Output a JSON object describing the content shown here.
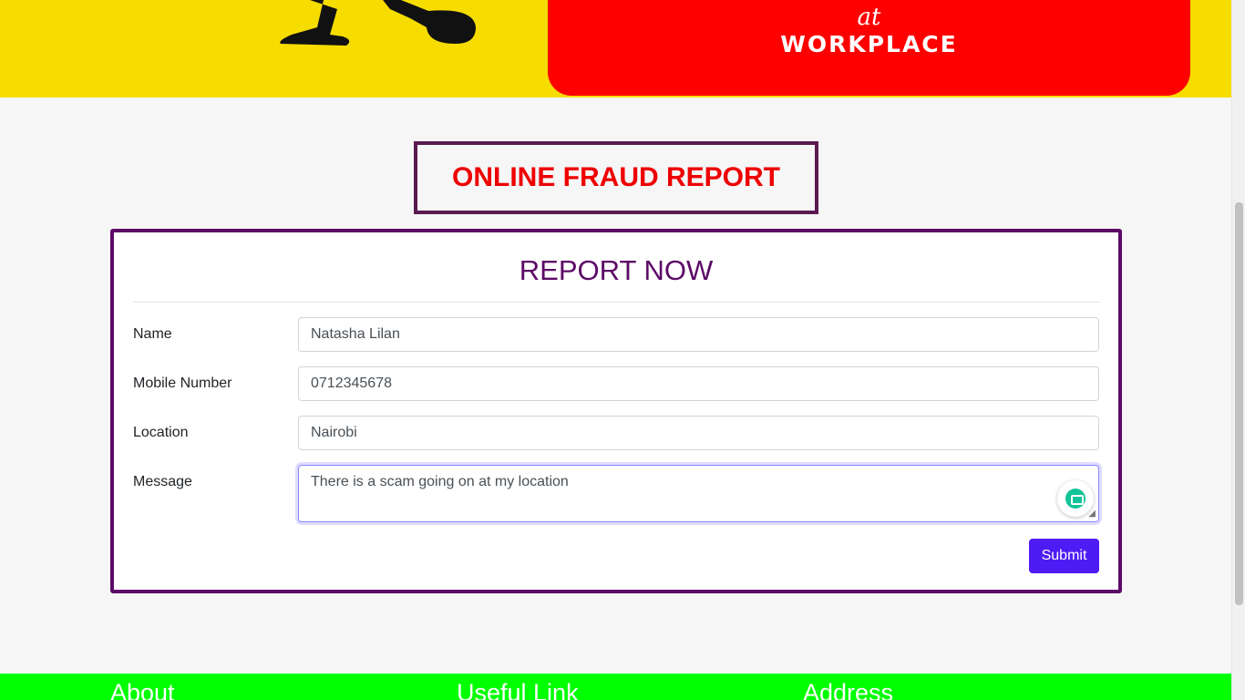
{
  "banner": {
    "tag_word": "at",
    "headline": "WORKPLACE",
    "colors": {
      "background": "#f7dc00",
      "panel": "#ff0000"
    }
  },
  "page_title": "ONLINE FRAUD REPORT",
  "form": {
    "heading": "REPORT NOW",
    "fields": [
      {
        "label": "Name",
        "value": "Natasha Lilan"
      },
      {
        "label": "Mobile Number",
        "value": "0712345678"
      },
      {
        "label": "Location",
        "value": "Nairobi"
      },
      {
        "label": "Message",
        "value": "There is a scam going on at my location"
      }
    ],
    "submit_label": "Submit",
    "grammar_icon": "grammarly-icon"
  },
  "footer": {
    "columns": [
      "About",
      "Useful Link",
      "Address"
    ],
    "color": "#00ff00"
  }
}
